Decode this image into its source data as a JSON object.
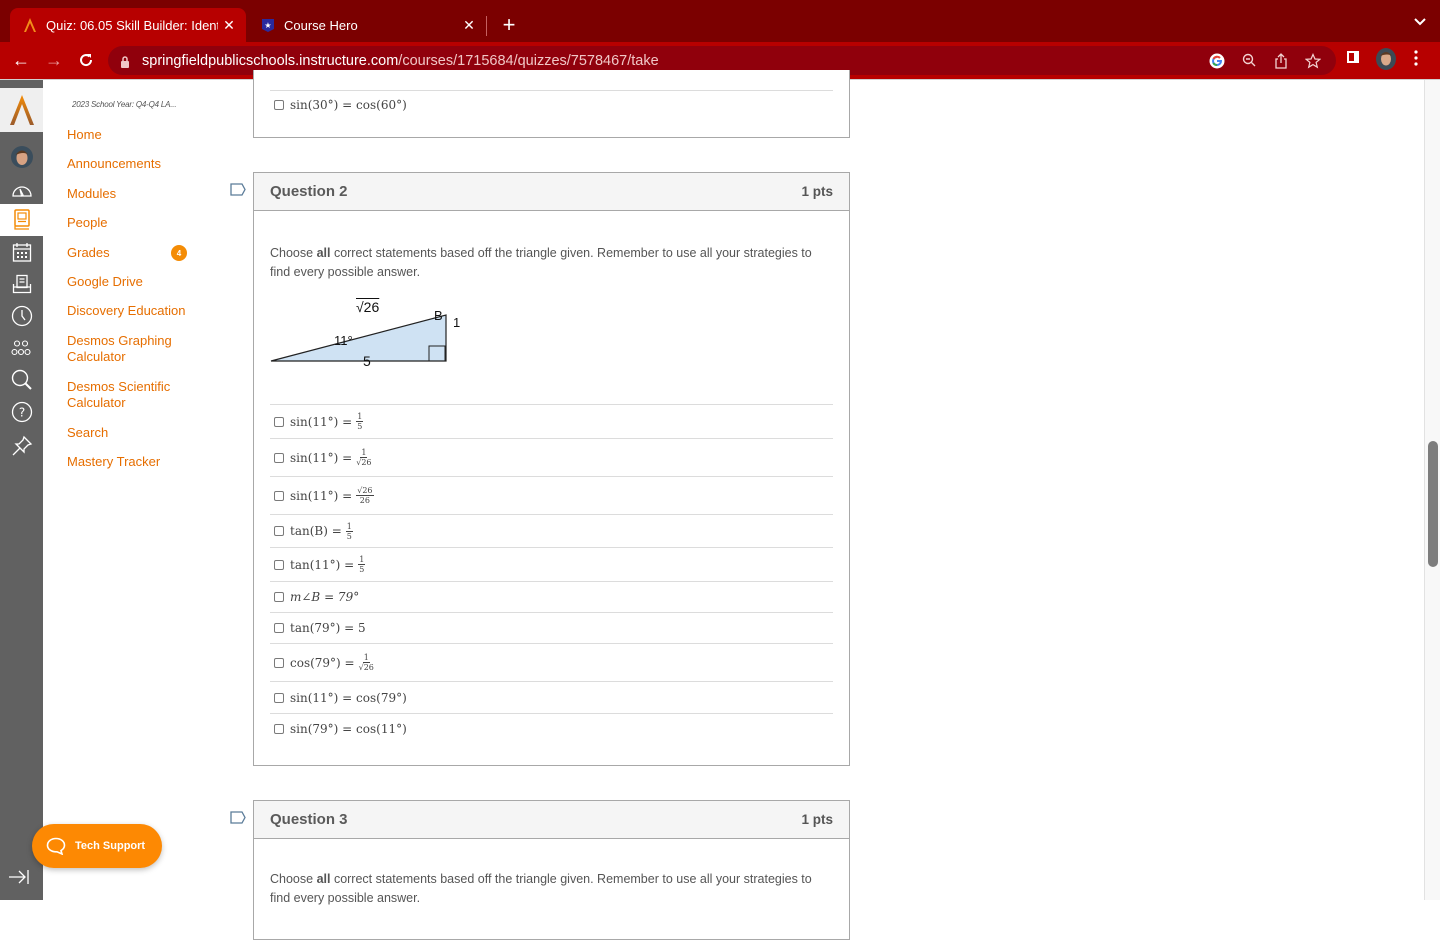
{
  "browser": {
    "tabs": [
      {
        "title": "Quiz: 06.05 Skill Builder: Identi",
        "favicon": "canvas-logo-icon",
        "active": true
      },
      {
        "title": "Course Hero",
        "favicon": "course-hero-icon",
        "active": false
      }
    ],
    "close_glyph": "✕",
    "new_tab_glyph": "+",
    "tab_search_glyph": "⌄",
    "url_host": "springfieldpublicschools.instructure.com",
    "url_path": "/courses/1715684/quizzes/7578467/take",
    "nav": {
      "back": "←",
      "forward": "→",
      "reload": "C"
    },
    "toolbar_icons": [
      "google-icon",
      "zoom-out-icon",
      "share-icon",
      "bookmark-star-icon",
      "side-panel-icon",
      "profile-avatar",
      "menu-icon"
    ]
  },
  "global_nav": {
    "items": [
      "account",
      "dashboard",
      "courses",
      "calendar",
      "inbox",
      "history",
      "groups",
      "search",
      "help",
      "commons"
    ],
    "active": "courses",
    "collapse_glyph": "→|"
  },
  "course_nav": {
    "course_label": "2023 School Year: Q4-Q4 LA...",
    "links": [
      {
        "label": "Home"
      },
      {
        "label": "Announcements"
      },
      {
        "label": "Modules"
      },
      {
        "label": "People"
      },
      {
        "label": "Grades",
        "badge": "4"
      },
      {
        "label": "Google Drive"
      },
      {
        "label": "Discovery Education"
      },
      {
        "label": "Desmos Graphing Calculator"
      },
      {
        "label": "Desmos Scientific Calculator"
      },
      {
        "label": "Search"
      },
      {
        "label": "Mastery Tracker"
      }
    ]
  },
  "tech_support": {
    "label": "Tech Support"
  },
  "question1": {
    "last_answer": "sin(30°) = cos(60°)"
  },
  "question2": {
    "title": "Question 2",
    "points": "1 pts",
    "prompt_before": "Choose ",
    "prompt_bold": "all",
    "prompt_after": " correct statements based off the triangle given. Remember to use all your strategies to find every possible answer.",
    "triangle": {
      "hypotenuse": "√26",
      "angle_a": "11°",
      "angle_b_label": "B",
      "opposite": "1",
      "adjacent": "5",
      "fill": "#cfe2f3"
    },
    "answers": [
      {
        "lhs": "sin(11°) =",
        "num": "1",
        "den": "5"
      },
      {
        "lhs": "sin(11°) =",
        "num": "1",
        "den": "√26"
      },
      {
        "lhs": "sin(11°) =",
        "num": "√26",
        "den": "26"
      },
      {
        "lhs": "tan(B) =",
        "num": "1",
        "den": "5"
      },
      {
        "lhs": "tan(11°) =",
        "num": "1",
        "den": "5"
      },
      {
        "lhs": "m∠B = 79°"
      },
      {
        "lhs": "tan(79°) = 5"
      },
      {
        "lhs": "cos(79°) =",
        "num": "1",
        "den": "√26"
      },
      {
        "lhs": "sin(11°) = cos(79°)"
      },
      {
        "lhs": "sin(79°) = cos(11°)"
      }
    ]
  },
  "question3": {
    "title": "Question 3",
    "points": "1 pts",
    "prompt_before": "Choose ",
    "prompt_bold": "all",
    "prompt_after": " correct statements based off the triangle given. Remember to use all your strategies to find every possible answer."
  },
  "colors": {
    "accent": "#e66e00",
    "chrome_dark": "#7b0000",
    "chrome": "#b70000",
    "global_nav": "#616161"
  }
}
